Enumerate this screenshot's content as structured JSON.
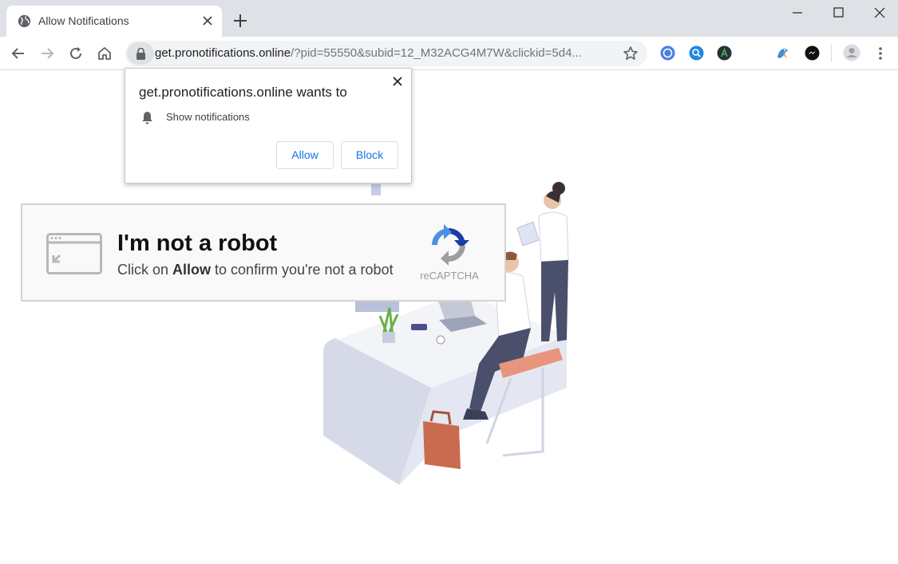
{
  "browser": {
    "tab": {
      "title": "Allow Notifications",
      "favicon": "globe-icon"
    },
    "url": {
      "host": "get.pronotifications.online",
      "path": "/?pid=55550&subid=12_M32ACG4M7W&clickid=5d4..."
    },
    "extensions": [
      "globe-extension-icon",
      "search-extension-icon",
      "a-extension-icon",
      "bird-extension-icon",
      "messenger-extension-icon"
    ]
  },
  "permission_bubble": {
    "title": "get.pronotifications.online wants to",
    "permission": "Show notifications",
    "allow_label": "Allow",
    "block_label": "Block",
    "accent_color": "#1a73e8"
  },
  "captcha": {
    "title": "I'm not a robot",
    "sub_before": "Click on ",
    "sub_bold": "Allow",
    "sub_after": " to confirm you're not a robot",
    "brand": "reCAPTCHA"
  }
}
